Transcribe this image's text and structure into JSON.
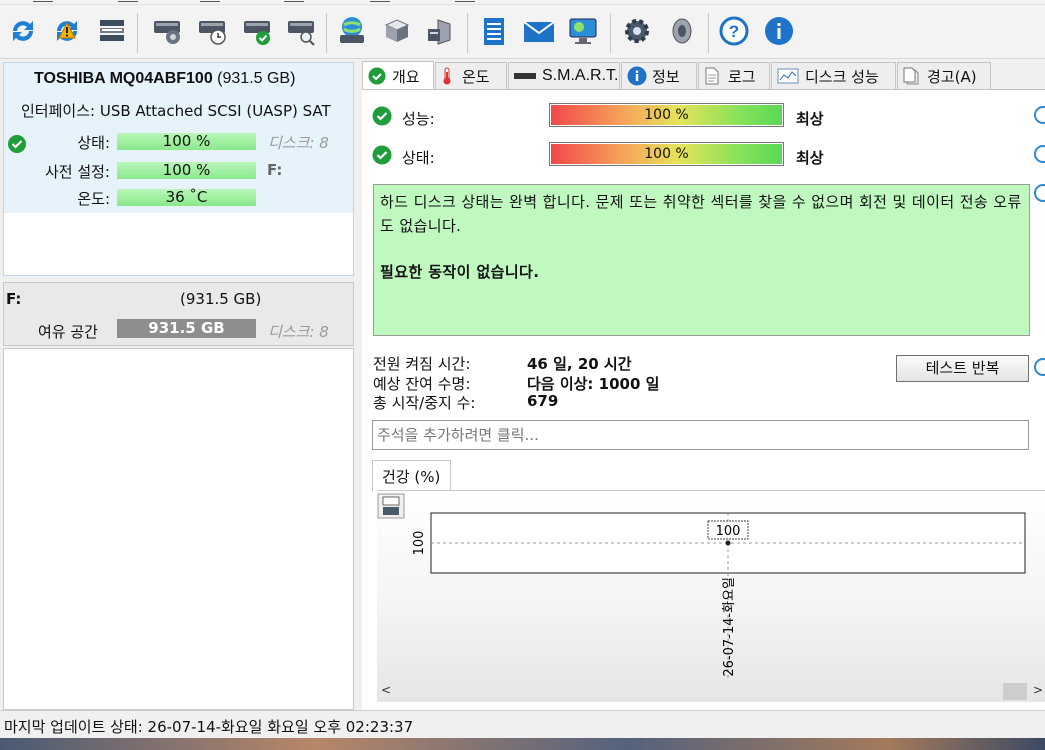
{
  "toolbar": {
    "buttons": [
      {
        "name": "refresh-icon"
      },
      {
        "name": "refresh-warning-icon"
      },
      {
        "name": "disk-list-icon"
      },
      {
        "name": "disk-surface-icon"
      },
      {
        "name": "disk-schedule-icon"
      },
      {
        "name": "disk-ok-icon"
      },
      {
        "name": "disk-search-icon"
      },
      {
        "name": "network-disk-icon"
      },
      {
        "name": "server-icon"
      },
      {
        "name": "computer-disk-icon"
      },
      {
        "name": "notepad-icon"
      },
      {
        "name": "mail-icon"
      },
      {
        "name": "monitor-icon"
      },
      {
        "name": "settings-gear-icon"
      },
      {
        "name": "speaker-icon"
      },
      {
        "name": "help-icon"
      },
      {
        "name": "info-icon"
      }
    ]
  },
  "disk": {
    "model": "TOSHIBA MQ04ABF100",
    "size": "(931.5 GB)",
    "interface_label": "인터페이스:",
    "interface_value": "USB Attached SCSI (UASP) SAT",
    "status_label": "상태:",
    "status_value": "100 %",
    "preset_label": "사전 설정:",
    "preset_value": "100 %",
    "temp_label": "온도:",
    "temp_value": "36 ˚C",
    "disk_num": "디스크: 8",
    "drive_letter": "F:"
  },
  "partition": {
    "letter": "F:",
    "size": "(931.5 GB)",
    "free_label": "여유 공간",
    "free_value": "931.5 GB",
    "disk_num": "디스크: 8"
  },
  "tabs": [
    "개요",
    "온도",
    "S.M.A.R.T.",
    "정보",
    "로그",
    "디스크 성능",
    "경고(A)"
  ],
  "overview": {
    "performance_label": "성능:",
    "performance_value": "100 %",
    "performance_rating": "최상",
    "health_label": "상태:",
    "health_value": "100 %",
    "health_rating": "최상",
    "message": "하드 디스크 상태는 완벽 합니다. 문제 또는 취약한 섹터를 찾을 수 없으며 회전 및 데이터 전송 오류도 없습니다.",
    "action": "필요한 동작이 없습니다.",
    "power_on_label": "전원 켜짐 시간:",
    "power_on_value": "46 일, 20 시간",
    "lifetime_label": "예상 잔여 수명:",
    "lifetime_value": "다음 이상: 1000 일",
    "start_stop_label": "총 시작/중지 수:",
    "start_stop_value": "679",
    "repeat_test_button": "테스트 반복",
    "comment_placeholder": "주석을 추가하려면 클릭..."
  },
  "chart_tab": "건강 (%)",
  "chart_data": {
    "type": "line",
    "x": [
      "26-07-14-화요일"
    ],
    "series": [
      {
        "values": [
          100
        ]
      }
    ],
    "y_tick": "100",
    "point_label": "100"
  },
  "statusbar": {
    "text": "마지막 업데이트 상태: 26-07-14-화요일 화요일 오후 02:23:37"
  },
  "colors": {
    "good_green": "#bff9bf",
    "accent_blue": "#2f8ad1"
  }
}
